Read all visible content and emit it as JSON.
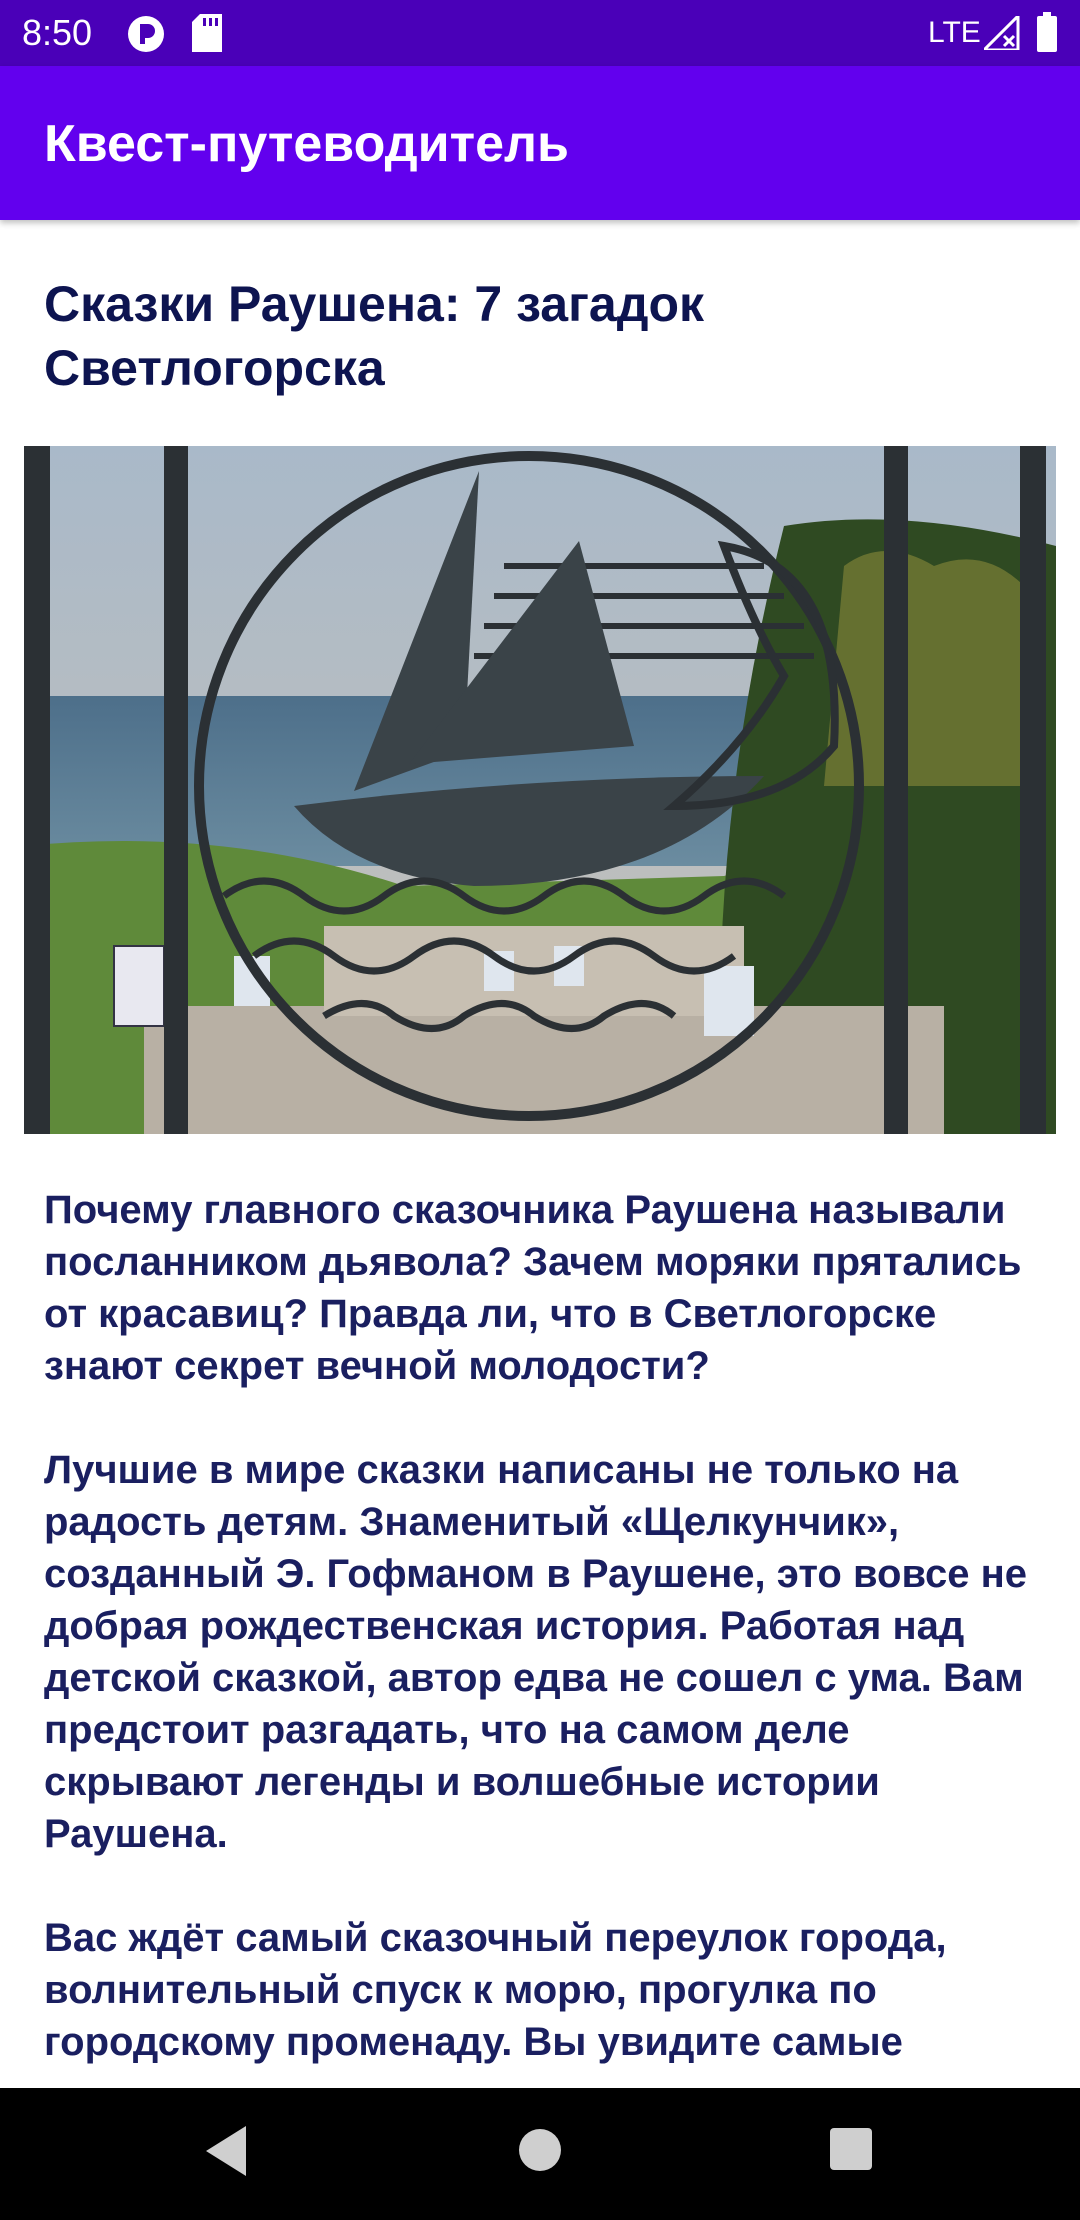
{
  "status_bar": {
    "time": "8:50",
    "network": "LTE",
    "icons": [
      "notification-app-icon",
      "sd-card-icon",
      "signal-icon",
      "battery-icon"
    ]
  },
  "app_bar": {
    "title": "Квест-путеводитель"
  },
  "tour": {
    "title": "Сказки Раушена: 7 загадок Светлогорска",
    "image_description": "wrought-iron sailboat emblem over Svetlogorsk seafront stairs",
    "paragraphs": [
      "Почему главного сказочника Раушена называли посланником дьявола? Зачем моряки прятались от красавиц? Правда ли, что в Светлогорске знают секрет вечной молодости?",
      "Лучшие в мире сказки написаны не только на радость детям. Знаменитый «Щелкунчик», созданный Э. Гофманом в Раушене, это вовсе не добрая рождественская история. Работая над детской сказкой, автор едва не сошел с ума. Вам предстоит разгадать, что на самом деле скрывают легенды и волшебные истории Раушена.",
      "Вас ждёт самый сказочный переулок города, волнительный спуск к морю, прогулка по городскому променаду. Вы увидите самые"
    ]
  },
  "nav_bar": {
    "buttons": [
      "back-icon",
      "home-icon",
      "recents-icon"
    ]
  },
  "colors": {
    "status_bar": "#4a00b8",
    "app_bar": "#6200ee",
    "title_text": "#0d1450",
    "body_text": "#1a1f60"
  }
}
